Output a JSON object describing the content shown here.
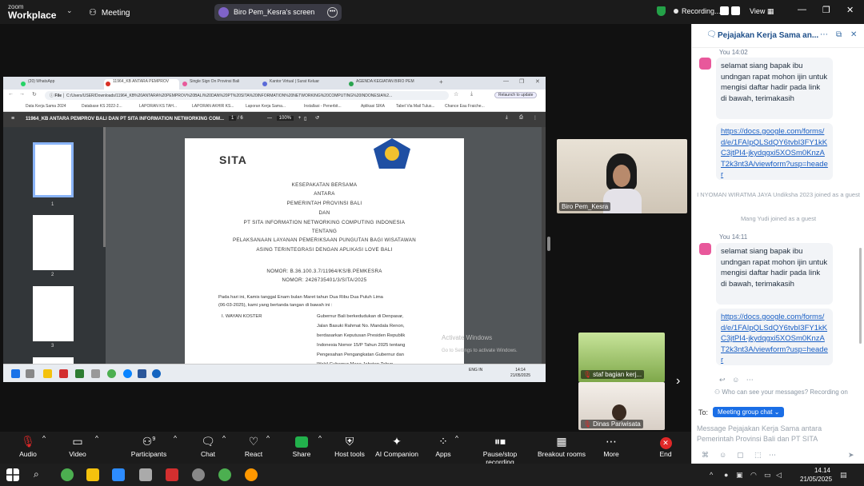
{
  "app": {
    "logo_top": "zoom",
    "logo_bottom": "Workplace",
    "meeting_label": "Meeting",
    "share_pill": "Biro Pem_Kesra's screen",
    "recording_label": "Recording...",
    "view_label": "View"
  },
  "browser": {
    "tabs": [
      {
        "label": "(20) WhatsApp",
        "color": "#25d366"
      },
      {
        "label": "11964_KB ANTARA PEMPROV",
        "color": "#d93025"
      },
      {
        "label": "Single Sign On Provinsi Bali",
        "color": "#e85a9b"
      },
      {
        "label": "Kantor Virtual | Surat Keluar",
        "color": "#5a6ad8"
      },
      {
        "label": "AGENDA KEGIATAN BIRO PEM",
        "color": "#2aa44f"
      }
    ],
    "address": "C:/Users/USER/Downloads/11964_KB%20ANTARA%20PEMPROV%20BALI%20DAN%20PT%20SITA%20INFORMATION%20NETWORKING%20COMPUTING%20INDONESIA%2...",
    "file_label": "File",
    "update_label": "Relaunch to update",
    "bookmarks": [
      "Data Kerja Sama 2024",
      "Database KS 2022-2...",
      "LAPORAN KS TAH...",
      "LAPORAN AKHIR KS...",
      "Laporan Kerja Sama...",
      "Installasi - Penerbit...",
      "Aplikasi SIKA",
      "Tabel Via Mail Tulus...",
      "Chance Eau Fraiche..."
    ]
  },
  "pdf": {
    "title": "11964_KB ANTARA PEMPROV BALI DAN PT SITA INFORMATION NETWORKING COM...",
    "page_current": "1",
    "page_sep": "/",
    "page_total": "6",
    "zoom": "100%",
    "thumb_numbers": [
      "1",
      "2",
      "3"
    ],
    "doc": {
      "logo": "SITA",
      "line1": "KESEPAKATAN BERSAMA",
      "line2": "ANTARA",
      "line3": "PEMERINTAH PROVINSI BALI",
      "line4": "DAN",
      "line5": "PT SITA INFORMATION NETWORKING COMPUTING INDONESIA",
      "line6": "TENTANG",
      "line7": "PELAKSANAAN LAYANAN PEMERIKSAAN PUNGUTAN BAGI WISATAWAN",
      "line8": "ASING TERINTEGRASI DENGAN APLIKASI LOVE BALI",
      "nomor1": "NOMOR: B.36.100.3.7/11964/KS/B.PEMKESRA",
      "nomor2": "NOMOR: 2426735401/3/SITA/2025",
      "para1": "Pada hari ini, Kamis tanggal Enam bulan Maret tahun Dua Ribu Dua Puluh Lima",
      "para2": "(06-03-2025), kami yang bertanda tangan di bawah ini :",
      "party": "I.  WAYAN KOSTER",
      "r1": "Gubernur Bali berkedudukan di Denpasar,",
      "r2": "Jalan Basuki Rahmat No. Mandala Renon,",
      "r3": "berdasarkan Keputusan Presiden Republik",
      "r4": "Indonesia Nomor 15/P Tahun 2025 tentang",
      "r5": "Pengesahan Pengangkatan Gubernur dan",
      "r6": "Wakil  Gubernur  Masa  Jabatan  Tahun"
    },
    "watermark_title": "Activate Windows",
    "watermark_sub": "Go to Settings to activate Windows.",
    "inner_clock_time": "14:14",
    "inner_clock_date": "21/05/2025",
    "inner_lang": "ENG IN"
  },
  "videos": [
    {
      "name": "Biro Pem_Kesra"
    },
    {
      "name": "staf bagian kerj..."
    },
    {
      "name": "Dinas Pariwisata"
    }
  ],
  "chat": {
    "title": "Pejajakan Kerja Sama an...",
    "messages": [
      {
        "time": "You 14:02",
        "text": "selamat siang bapak ibu undngan rapat mohon ijin untuk mengisi daftar hadir pada link di bawah, terimakasih",
        "link": "https://docs.google.com/forms/d/e/1FAIpQLSdQY6tvbI3FY1kKC3jtPI4-jkydqgxi5XOSm0KnzAT2k3nt3A/viewform?usp=header"
      },
      {
        "time": "You 14:11",
        "text": "selamat siang bapak ibu undngan rapat mohon ijin untuk mengisi daftar hadir pada link di bawah, terimakasih",
        "link": "https://docs.google.com/forms/d/e/1FAIpQLSdQY6tvbI3FY1kKC3jtPI4-jkydqgxi5XOSm0KnzAT2k3nt3A/viewform?usp=header"
      }
    ],
    "system1": "I NYOMAN WIRATMA JAYA Undiksha 2023 joined as a guest",
    "system2": "Mang Yudi joined as a guest",
    "who_can_see": "Who can see your messages? Recording on",
    "to_label": "To:",
    "to_value": "Meeting group chat",
    "compose_placeholder": "Message Pejajakan Kerja Sama antara Pemerintah Provinsi Bali dan PT SITA"
  },
  "toolbar": {
    "audio": "Audio",
    "video": "Video",
    "participants": "Participants",
    "participants_count": "9",
    "chat": "Chat",
    "react": "React",
    "share": "Share",
    "host_tools": "Host tools",
    "ai_companion": "AI Companion",
    "apps": "Apps",
    "pause_stop": "Pause/stop recording",
    "breakout": "Breakout rooms",
    "more": "More",
    "end": "End"
  },
  "taskbar": {
    "time": "14.14",
    "date": "21/05/2025"
  }
}
